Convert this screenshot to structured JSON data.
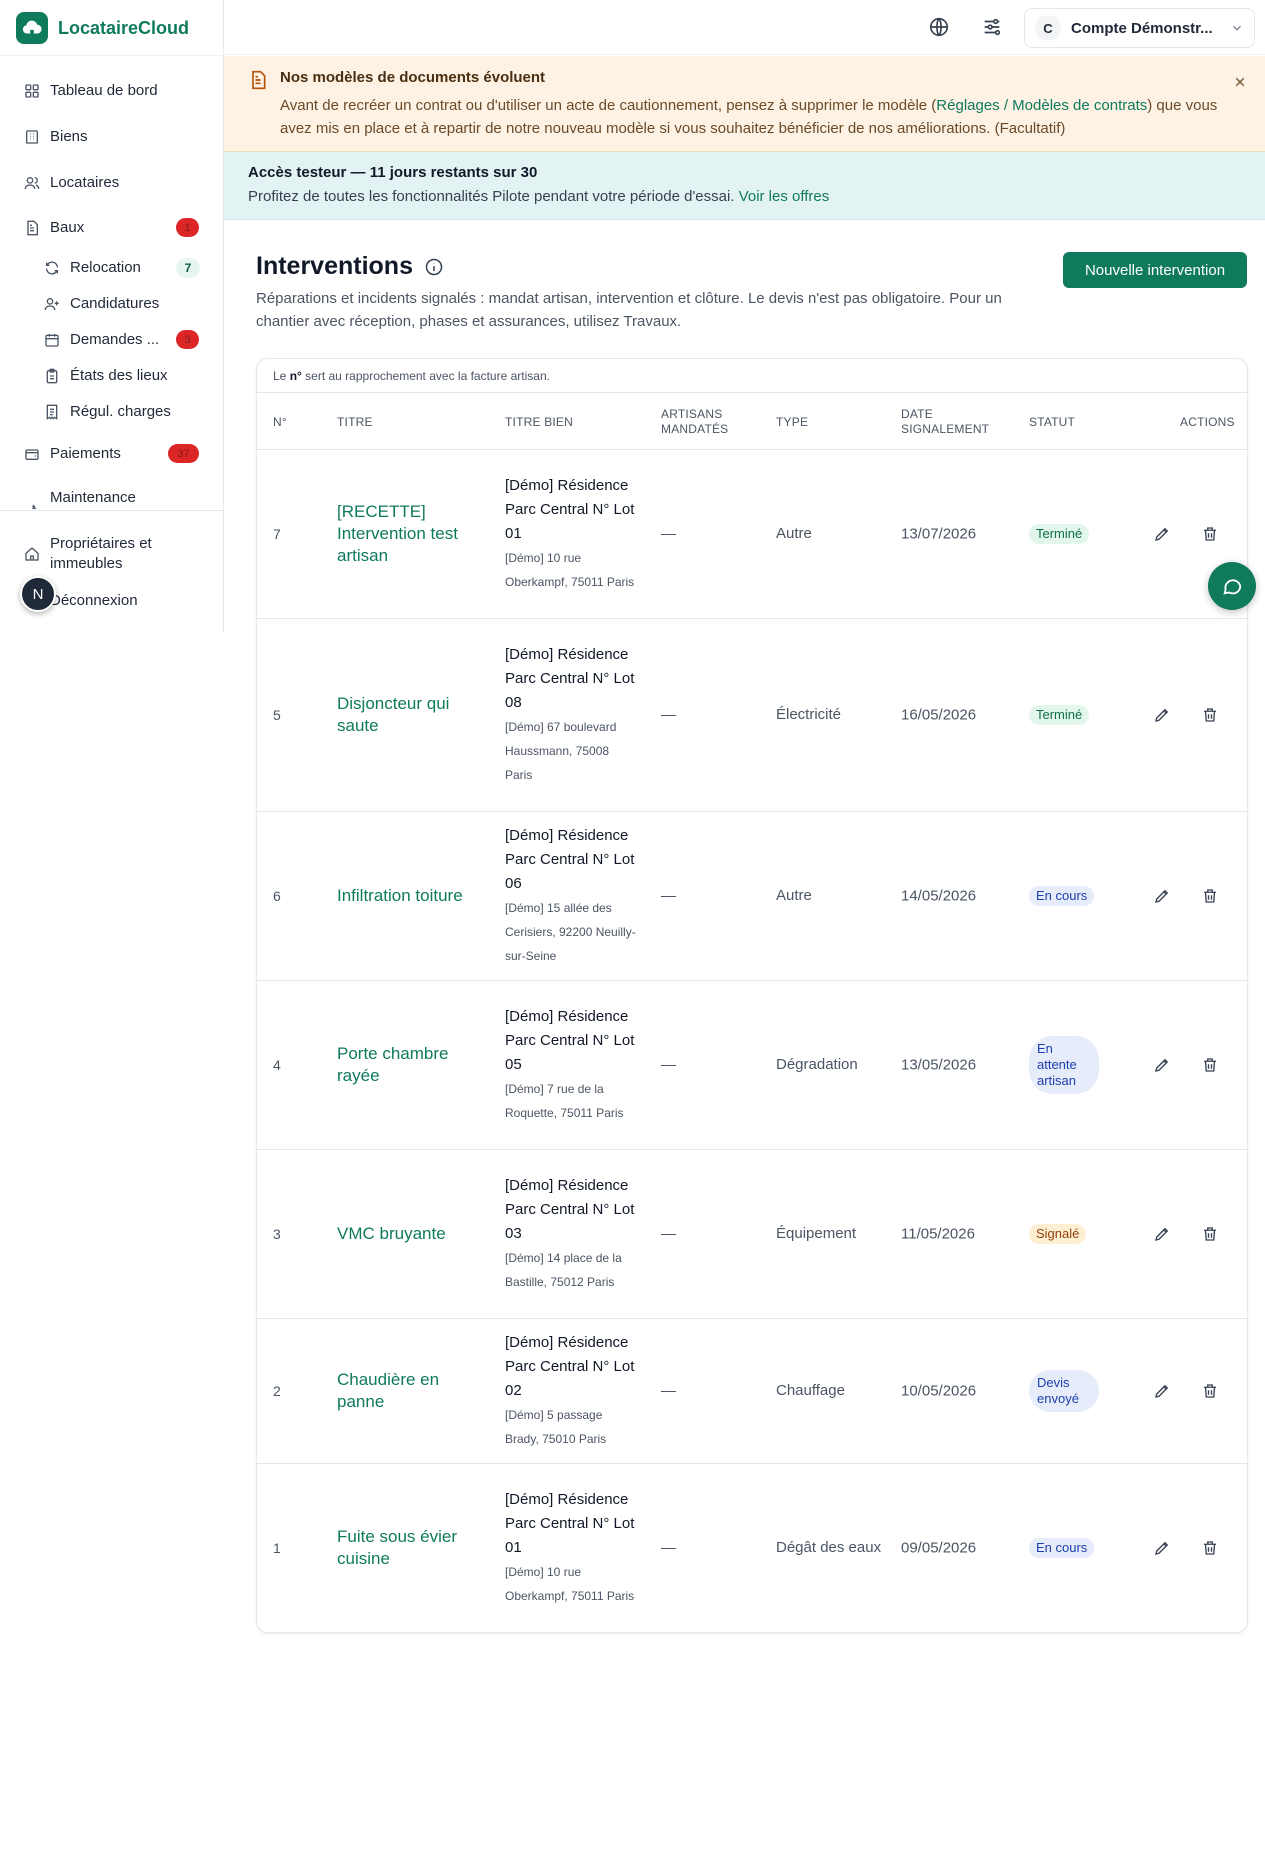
{
  "app": {
    "name": "LocataireCloud",
    "brand_color": "#0f7a5c"
  },
  "sidebar": {
    "items": [
      {
        "label": "Tableau de bord",
        "icon": "dashboard-icon"
      },
      {
        "label": "Biens",
        "icon": "building-icon"
      },
      {
        "label": "Locataires",
        "icon": "users-icon"
      },
      {
        "label": "Baux",
        "icon": "document-icon",
        "badge": "1"
      }
    ],
    "sub_items": [
      {
        "label": "Relocation",
        "icon": "refresh-icon",
        "badge": "7"
      },
      {
        "label": "Candidatures",
        "icon": "user-plus-icon"
      },
      {
        "label": "Demandes ...",
        "icon": "calendar-icon",
        "badge": "3"
      },
      {
        "label": "États des lieux",
        "icon": "clipboard-icon"
      },
      {
        "label": "Régul. charges",
        "icon": "receipt-icon"
      }
    ],
    "more_items": [
      {
        "label": "Paiements",
        "icon": "wallet-icon",
        "badge": "37"
      },
      {
        "label": "Maintenance",
        "icon": "wrench-icon"
      }
    ],
    "footer_items": [
      {
        "label": "Propriétaires et immeubles",
        "icon": "home-icon"
      },
      {
        "label": "Déconnexion",
        "icon": "logout-icon"
      }
    ],
    "avatar_initial": "N"
  },
  "topbar": {
    "account_initial": "C",
    "account_name": "Compte Démonstr..."
  },
  "warning_banner": {
    "title": "Nos modèles de documents évoluent",
    "body_before": "Avant de recréer un contrat ou d'utiliser un acte de cautionnement, pensez à supprimer le modèle (",
    "link": "Réglages / Modèles de contrats",
    "body_after": ") que vous avez mis en place et à repartir de notre nouveau modèle si vous souhaitez bénéficier de nos améliorations. (Facultatif)"
  },
  "trial_banner": {
    "title": "Accès testeur — 11 jours restants sur 30",
    "body": "Profitez de toutes les fonctionnalités Pilote pendant votre période d'essai. ",
    "link": "Voir les offres"
  },
  "page": {
    "title": "Interventions",
    "description": "Réparations et incidents signalés : mandat artisan, intervention et clôture. Le devis n'est pas obligatoire. Pour un chantier avec réception, phases et assurances, utilisez Travaux.",
    "new_button": "Nouvelle intervention"
  },
  "table": {
    "note_before": "Le ",
    "note_bold": "n°",
    "note_after": " sert au rapprochement avec la facture artisan.",
    "headers": {
      "num": "N°",
      "title": "Titre",
      "bien": "Titre bien",
      "artisans": "Artisans mandatés",
      "type": "Type",
      "date": "Date signalement",
      "status": "Statut",
      "actions": "Actions"
    },
    "rows": [
      {
        "num": "7",
        "title": "[RECETTE] Intervention test artisan",
        "bien": "[Démo] Résidence Parc Central N° Lot 01",
        "addr": "[Démo] 10 rue Oberkampf, 75011 Paris",
        "artisans": "—",
        "type": "Autre",
        "date": "13/07/2026",
        "status": "Terminé",
        "status_kind": "done"
      },
      {
        "num": "5",
        "title": "Disjoncteur qui saute",
        "bien": "[Démo] Résidence Parc Central N° Lot 08",
        "addr": "[Démo] 67 boulevard Haussmann, 75008 Paris",
        "artisans": "—",
        "type": "Électricité",
        "date": "16/05/2026",
        "status": "Terminé",
        "status_kind": "done"
      },
      {
        "num": "6",
        "title": "Infiltration toiture",
        "bien": "[Démo] Résidence Parc Central N° Lot 06",
        "addr": "[Démo] 15 allée des Cerisiers, 92200 Neuilly-sur-Seine",
        "artisans": "—",
        "type": "Autre",
        "date": "14/05/2026",
        "status": "En cours",
        "status_kind": "prog"
      },
      {
        "num": "4",
        "title": "Porte chambre rayée",
        "bien": "[Démo] Résidence Parc Central N° Lot 05",
        "addr": "[Démo] 7 rue de la Roquette, 75011 Paris",
        "artisans": "—",
        "type": "Dégradation",
        "date": "13/05/2026",
        "status": "En attente artisan",
        "status_kind": "wait"
      },
      {
        "num": "3",
        "title": "VMC bruyante",
        "bien": "[Démo] Résidence Parc Central N° Lot 03",
        "addr": "[Démo] 14 place de la Bastille, 75012 Paris",
        "artisans": "—",
        "type": "Équipement",
        "date": "11/05/2026",
        "status": "Signalé",
        "status_kind": "sig"
      },
      {
        "num": "2",
        "title": "Chaudière en panne",
        "bien": "[Démo] Résidence Parc Central N° Lot 02",
        "addr": "[Démo] 5 passage Brady, 75010 Paris",
        "artisans": "—",
        "type": "Chauffage",
        "date": "10/05/2026",
        "status": "Devis envoyé",
        "status_kind": "wait"
      },
      {
        "num": "1",
        "title": "Fuite sous évier cuisine",
        "bien": "[Démo] Résidence Parc Central N° Lot 01",
        "addr": "[Démo] 10 rue Oberkampf, 75011 Paris",
        "artisans": "—",
        "type": "Dégât des eaux",
        "date": "09/05/2026",
        "status": "En cours",
        "status_kind": "prog"
      }
    ]
  }
}
